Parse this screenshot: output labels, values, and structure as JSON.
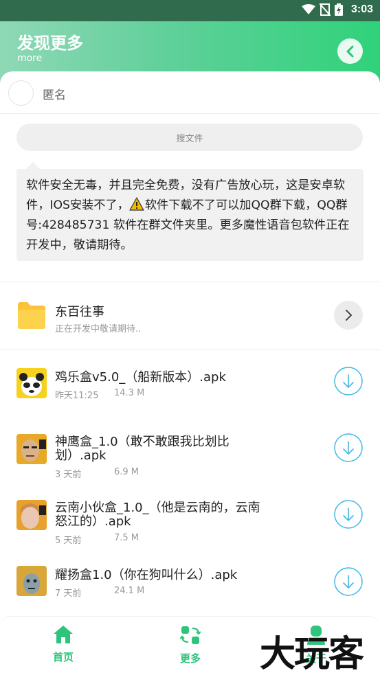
{
  "status_bar": {
    "time": "3:03"
  },
  "header": {
    "title": "发现更多",
    "subtitle": "more"
  },
  "user": {
    "name": "匿名"
  },
  "search": {
    "placeholder": "搜文件"
  },
  "notice": {
    "line1": "软件安全无毒，并且完全免费，没有广告放心玩，这是安卓软件，IOS安装不了，",
    "line2": "软件下载不了可以加QQ群下载，QQ群号:428485731 软件在群文件夹里。更多魔性语音包软件正在开发中，敬请期待。"
  },
  "folder": {
    "title": "东百往事",
    "desc": "正在开发中敬请期待.."
  },
  "files": [
    {
      "name": "鸡乐盒v5.0_（船新版本）.apk",
      "time": "昨天11:25",
      "size": "14.3 M"
    },
    {
      "name": "神鹰盒_1.0（敢不敢跟我比划比划）.apk",
      "time": "3 天前",
      "size": "6.9 M"
    },
    {
      "name": "云南小伙盒_1.0_（他是云南的，云南怒江的）.apk",
      "time": "5 天前",
      "size": "7.5 M"
    },
    {
      "name": "耀扬盒1.0（你在狗叫什么）.apk",
      "time": "7 天前",
      "size": "24.1 M"
    }
  ],
  "tabs": [
    {
      "label": "首页",
      "icon": "home-icon"
    },
    {
      "label": "更多",
      "icon": "swap-icon"
    },
    {
      "label": "关于",
      "icon": "user-icon"
    }
  ],
  "watermark": "大玩客",
  "colors": {
    "accent": "#2fc47c",
    "header_start": "#8fd8b6",
    "header_end": "#2fd27a"
  }
}
